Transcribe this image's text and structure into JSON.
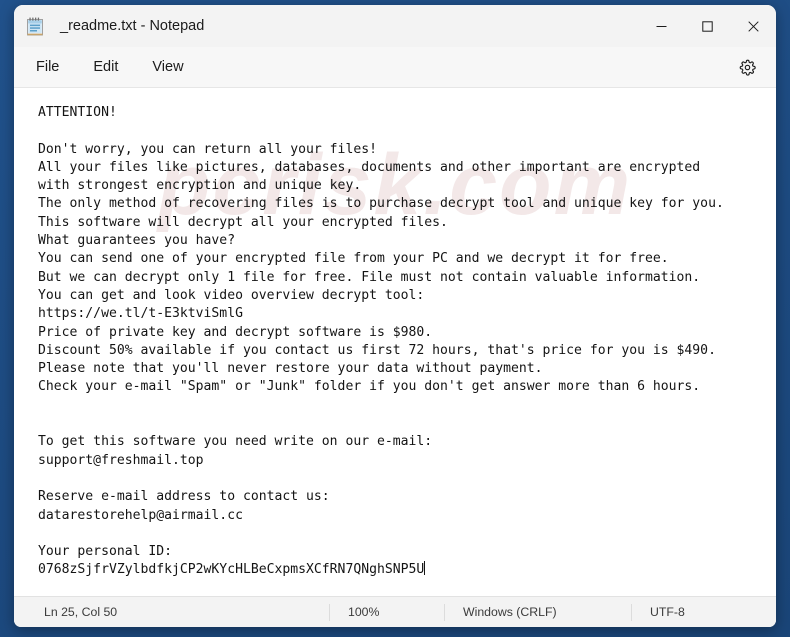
{
  "window": {
    "title": "_readme.txt - Notepad",
    "app_icon": "notepad-icon",
    "controls": {
      "minimize": "minimize-icon",
      "maximize": "maximize-icon",
      "close": "close-icon"
    }
  },
  "menu": {
    "items": [
      {
        "label": "File"
      },
      {
        "label": "Edit"
      },
      {
        "label": "View"
      }
    ],
    "settings_icon": "gear-icon"
  },
  "editor": {
    "watermark": "pcrisk.com",
    "content": "ATTENTION!\n\nDon't worry, you can return all your files!\nAll your files like pictures, databases, documents and other important are encrypted\nwith strongest encryption and unique key.\nThe only method of recovering files is to purchase decrypt tool and unique key for you.\nThis software will decrypt all your encrypted files.\nWhat guarantees you have?\nYou can send one of your encrypted file from your PC and we decrypt it for free.\nBut we can decrypt only 1 file for free. File must not contain valuable information.\nYou can get and look video overview decrypt tool:\nhttps://we.tl/t-E3ktviSmlG\nPrice of private key and decrypt software is $980.\nDiscount 50% available if you contact us first 72 hours, that's price for you is $490.\nPlease note that you'll never restore your data without payment.\nCheck your e-mail \"Spam\" or \"Junk\" folder if you don't get answer more than 6 hours.\n\n\nTo get this software you need write on our e-mail:\nsupport@freshmail.top\n\nReserve e-mail address to contact us:\ndatarestorehelp@airmail.cc\n\nYour personal ID:\n0768zSjfrVZylbdfkjCP2wKYcHLBeCxpmsXCfRN7QNghSNP5U"
  },
  "statusbar": {
    "position": "Ln 25, Col 50",
    "zoom": "100%",
    "line_ending": "Windows (CRLF)",
    "encoding": "UTF-8"
  },
  "colors": {
    "desktop": "#1f4e86",
    "window_chrome": "#f3f3f3",
    "editor_background": "#ffffff",
    "text": "#141414",
    "close_hover": "#c42b1c"
  }
}
